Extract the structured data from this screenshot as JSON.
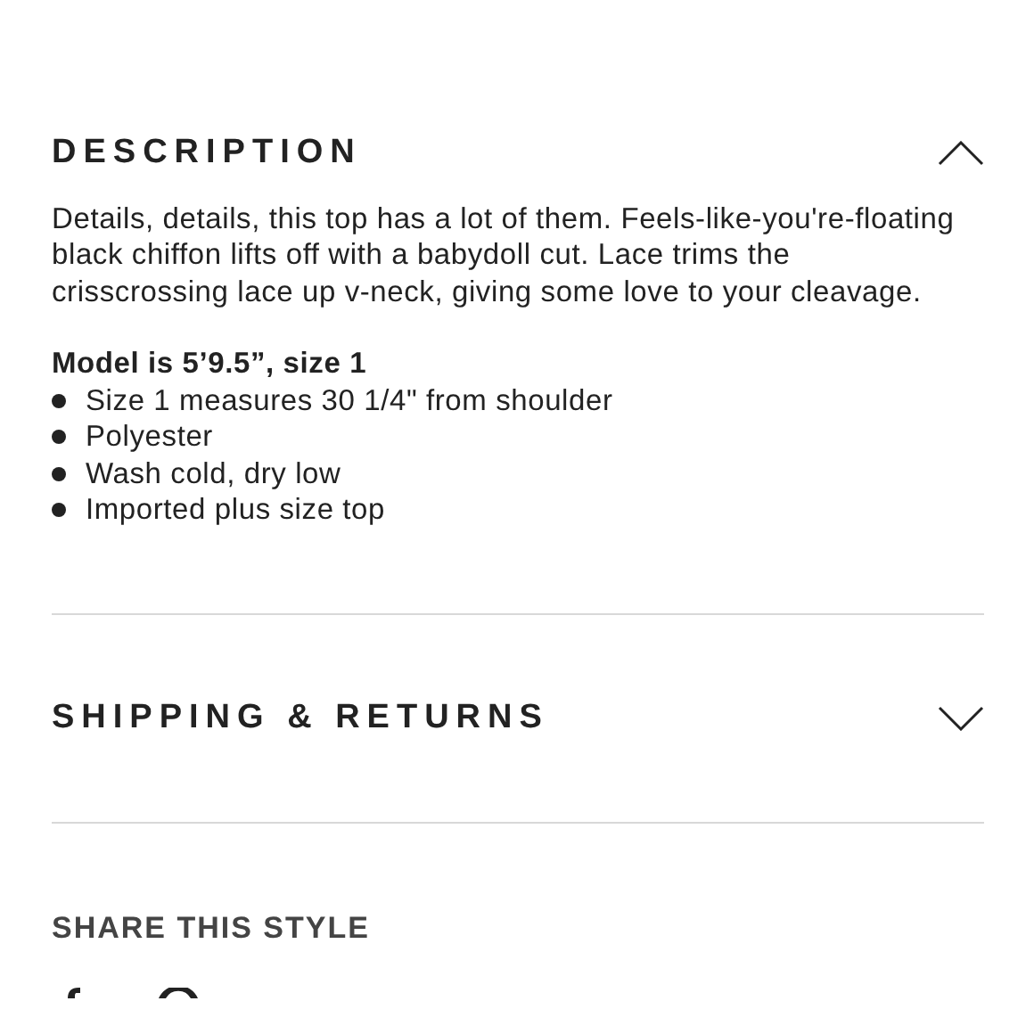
{
  "sections": [
    {
      "title": "DESCRIPTION",
      "expanded": true,
      "paragraph": "Details, details, this top has a lot of them. Feels-like-you're-floating black chiffon lifts off with a babydoll cut. Lace trims the crisscrossing lace up v-neck, giving some love to your cleavage.",
      "model_note": "Model is 5’9.5”, size 1",
      "bullets": [
        "Size 1 measures 30 1/4\" from shoulder",
        "Polyester",
        "Wash cold, dry low",
        "Imported plus size top"
      ]
    },
    {
      "title": "SHIPPING & RETURNS",
      "expanded": false
    }
  ],
  "share": {
    "title": "SHARE THIS STYLE"
  }
}
